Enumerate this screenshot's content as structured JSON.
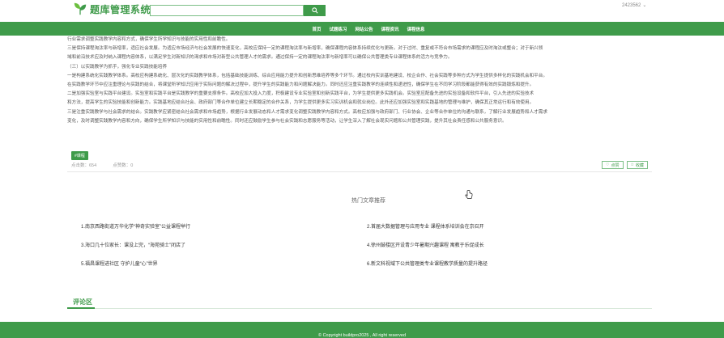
{
  "header": {
    "app_title": "题库管理系统",
    "search_placeholder": "",
    "search_icon": "search-icon",
    "user_name": "2423562",
    "user_caret": "⌄"
  },
  "nav": {
    "items": [
      {
        "label": "首页"
      },
      {
        "label": "试题练习"
      },
      {
        "label": "网站公告"
      },
      {
        "label": "课程资讯"
      },
      {
        "label": "课程信息"
      }
    ]
  },
  "article": {
    "lines": [
      "行业需求调整实践教学内容和方式，确保学生所学知识与技能的实用性和前瞻性。",
      "三是保持课程淘汰率与新增率，适应社会发展。为适应市场经济与社会发展的快速变化，高校应保持一定的课程淘汰率与新增率，确保课程内容体系持续优化与更新。对于过时、重复或不符合市场需求的课程应及时淘汰或整合；对于新兴领",
      "域和前沿技术应及时纳入课程内容体系，以满足学生对新知识的渴求和市场对新型公共管理人才的需求。通过保持一定的课程淘汰率与新增率可以确保公共管理类专业课程体系的活力与竞争力。",
      "（三）以实践教学为抓手，强化专业实践技能培养",
      "一是构建系统化实践教学体系。高校应构建系统化、层次化的实践教学体系，包括基础技能训练、综合应用能力提升和创新思维培养等多个环节。通过校内实训基地建设、校企合作、社会实践等多种方式为学生提供多样化的实践机会和平台。",
      "在实践教学环节中应注重理论与实践的结合，将课堂所学知识应用于实际问题的解决过程中，提升学生的实践能力和问题解决能力。同时还应注重实践教学的连续性和递进性，确保学生在不同学习阶段都能获得有效的实践锻炼和提升。",
      "二是加强实验室与实践平台建设。实验室和实践平台是实践教学的重要支撑条件。高校应加大投入力度，积极建设专业实验室和创新实践平台，为学生提供更多实践机会。实验室应配备先进的实验设备和软件平台，引入先进的实验技术",
      "和方法，提高学生的实验技能和创新能力。实践基地应结合社会、政府部门等合作单位建立长期稳定的合作关系，为学生提供更多实习实训机会和就业岗位。此外还应加强实验室和实践基地的管理与维护，确保其正常运行和有效使用。",
      "三是注重实践教学与社会需求的结合。实践教学应紧密结合社会需求和市场趋势，根据行业发展动态和人才需求变化调整实践教学内容和方式。高校应加强与政府部门、行业协会、企业等合作单位的沟通与联系，了解行业发展趋势和人才需求",
      "变化，及时调整实践教学内容和方向，确保学生所学知识与技能的实用性和前瞻性。同时还应鼓励学生参与社会实践和志愿服务等活动，让学生深入了解社会现实问题和公共管理实践，提升其社会责任感和公共服务意识。"
    ]
  },
  "post": {
    "tag": "#课程",
    "click_label": "点击数：654",
    "like_label": "点赞数：0",
    "like_button": "点赞",
    "collect_button": "收藏"
  },
  "recommend": {
    "title": "热门文章推荐",
    "items": [
      {
        "label": "1.南京西路街道万华化学“神奇实验室”公益课程举行"
      },
      {
        "label": "2.首届大数据管理与应用专业 课程体系培训会在京召开"
      },
      {
        "label": "3.海口几十位家长：课没上完，“海苑骑士”闭店了"
      },
      {
        "label": "4.徐州鼓楼区开设青少年暑期兴趣课程 寓教于乐促成长"
      },
      {
        "label": "5.福昌课程进社区 守护儿童“心”世界"
      },
      {
        "label": "6.新文科视域下公共管理类专业课程教学质量的提升路径"
      }
    ]
  },
  "comments": {
    "title": "评论区"
  },
  "footer": {
    "copyright": "© Copyright buildpro2025 , All right reserved"
  },
  "colors": {
    "brand": "#3f9b4a",
    "text": "#555555"
  }
}
